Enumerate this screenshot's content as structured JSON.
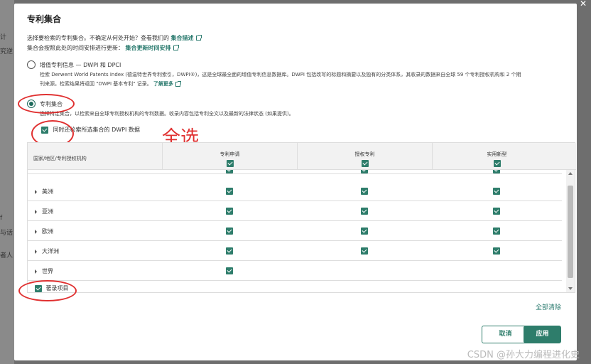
{
  "background": {
    "fragments": [
      "计",
      "究逆",
      "f",
      "与话",
      "者人"
    ]
  },
  "dialog": {
    "title": "专利集合",
    "intro_line1": "选择要检索的专利集合。不确定从何处开始？查看我们的",
    "intro_link1": "集合描述",
    "intro_line2": "集合会按照此处的时间安排进行更新：",
    "intro_link2": "集合更新时间安排"
  },
  "options": [
    {
      "label": "增值专利信息 — DWPI 和 DPCI",
      "selected": false,
      "desc_line1": "检索 Derwent World Patents Index (德温特世界专利索引，DWPI®)，这是全球最全面的增值专利信息数据库。DWPI 包括改写的标题和摘要以及独有的分类体系，其收录的数据来自全球 59 个专利授权机构和 2 个期",
      "desc_line2": "刊来源。检索结果将返回 \"DWPI 基本专利\" 记录。",
      "desc_link": "了解更多"
    },
    {
      "label": "专利集合",
      "selected": true,
      "desc_line1": "选择特定集合，以检索来自全球专利授权机构的专利数据。收录内容包括专利全文以及最新的法律状态 (如果提供)。"
    }
  ],
  "dwpi_checkbox": {
    "label": "同时还检索所选集合的 DWPI 数据",
    "checked": true
  },
  "annotation": {
    "text": "全选",
    "color": "#e03030"
  },
  "table": {
    "headers": [
      "国家/地区/专利授权机构",
      "专利申请",
      "授权专利",
      "实用新型"
    ],
    "rows": [
      {
        "name": "美洲",
        "cells": [
          true,
          true,
          true
        ]
      },
      {
        "name": "亚洲",
        "cells": [
          true,
          true,
          true
        ]
      },
      {
        "name": "欧洲",
        "cells": [
          true,
          true,
          true
        ]
      },
      {
        "name": "大洋洲",
        "cells": [
          true,
          true,
          true
        ]
      },
      {
        "name": "世界",
        "cells": [
          true,
          false,
          false
        ]
      }
    ],
    "footer_checkbox": {
      "label": "著录项目",
      "checked": true
    }
  },
  "actions": {
    "clear_all": "全部清除",
    "cancel": "取消",
    "apply": "应用"
  },
  "watermark": "CSDN @孙大力编程进化史",
  "colors": {
    "accent": "#2e7d6b",
    "link": "#2a7a6e"
  }
}
